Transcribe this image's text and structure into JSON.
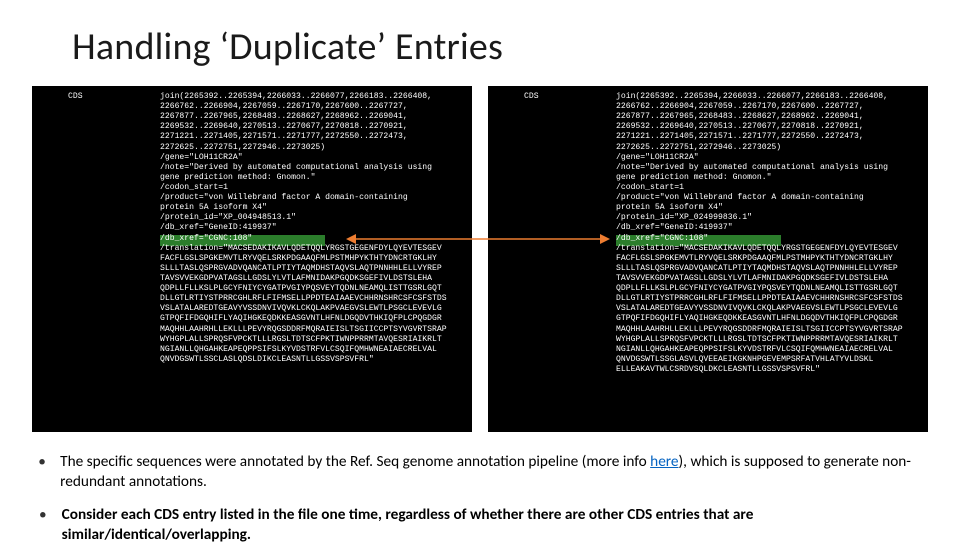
{
  "title": "Handling ‘Duplicate’ Entries",
  "cds_label": "CDS",
  "left_block": "join(2265392..2265394,2266033..2266077,2266183..2266408,\n2266762..2266904,2267059..2267170,2267600..2267727,\n2267877..2267965,2268483..2268627,2268962..2269041,\n2269532..2269640,2270513..2270677,2270818..2270921,\n2271221..2271405,2271571..2271777,2272550..2272473,\n2272625..2272751,2272946..2273025)\n/gene=\"LOH11CR2A\"\n/note=\"Derived by automated computational analysis using\ngene prediction method: Gnomon.\"\n/codon_start=1\n/product=\"von Willebrand factor A domain-containing\nprotein 5A isoform X4\"\n/protein_id=\"XP_004948513.1\"\n/db_xref=\"GeneID:419937\"\n/db_xref=\"CGNC:108\"\n/translation=\"MACSEDAKIKAVLQDETQQLYRGSTGEGENFDYLQYEVTESGEV\nFACFLGSLSPGKEMVTLRYVQELSRKPDGAAQFMLPSTMHPYKTHTYDNCRTGKLHY\nSLLLTASLQSPRGVADVQANCATLPTIYTAQMDHSTAQVSLAQTPNNHHLELLVYREP\nTAVSVVEKGDPVATAGSLLGDSLYLVTLAFMNIDAKPGQDKSGEFIVLDSTSLEHA\nQDPLLFLLKSLPLGCYFNIYCYGATPVGIYPQSVEYTQDNLNEAMQLISTTGSRLGQT\nDLLGTLRTIYSTPRRCGHLRFLFIFMSELLPPDTEAIAAEVCHHRNSHRCSFCSFSTDS\nVSLATALAREDTGEAVYVSSDNVIVQVKLCKQLAKPVAEGVSLEWTLPSGCLEVEVLG\nGTPQFIFDGQHIFLYAQIHGKEQDKKEASGVNTLHFNLDGQDVTHKIQFPLCPQGDGR\nMAQHHLAAHRHLLEKLLLPEVYRQGSDDRFMQRAIEISLTSGIICCPTSYVGVRTSRAP\nWYHGPLALLSPRQSFVPCKTLLLRGSLTDTSCFPKTIWNPPRRMTAVQESRIAIKRLT\nNGIANLLQHGAHKEAPEQPPSIFSLKYVDSTRFVLCSQIFQMHWNEAIAECRELVAL\nQNVDGSWTLSSCLASLQDSLDIKCLEASNTLLGSSVSPSVFRL\"",
  "right_block": "join(2265392..2265394,2266033..2266077,2266183..2266408,\n2266762..2266904,2267059..2267170,2267600..2267727,\n2267877..2267965,2268483..2268627,2268962..2269041,\n2269532..2269640,2270513..2270677,2270818..2270921,\n2271221..2271405,2271571..2271777,2272550..2272473,\n2272625..2272751,2272946..2273025)\n/gene=\"LOH11CR2A\"\n/note=\"Derived by automated computational analysis using\ngene prediction method: Gnomon.\"\n/codon_start=1\n/product=\"von Willebrand factor A domain-containing\nprotein 5A isoform X4\"\n/protein_id=\"XP_024999836.1\"\n/db_xref=\"GeneID:419937\"\n/db_xref=\"CGNC:108\"\n/translation=\"MACSEDAKIKAVLQDETQQLYRGSTGEGENFDYLQYEVTESGEV\nFACFLGSLSPGKEMVTLRYVQELSRKPDGAAQFMLPSTMHPYKTHTYDNCRTGKLHY\nSLLLTASLQSPRGVADVQANCATLPTIYTAQMDHSTAQVSLAQTPNNHHLELLVYREP\nTAVSVVEKGDPVATAGSLLGDSLYLVTLAFMNIDAKPGQDKSGEFIVLDSTSLEHA\nQDPLLFLLKSLPLGCYFNIYCYGATPVGIYPQSVEYTQDNLNEAMQLISTTGSRLGQT\nDLLGTLRTIYSTPRRCGHLRFLFIFMSELLPPDTEAIAAEVCHHRNSHRCSFCSFSTDS\nVSLATALAREDTGEAVYVSSDNVIVQVKLCKQLAKPVAEGVSLEWTLPSGCLEVEVLG\nGTPQFIFDGQHIFLYAQIHGKEQDKKEASGVNTLHFNLDGQDVTHKIQFPLCPQGDGR\nMAQHHLAAHRHLLEKLLLPEVYRQGSDDRFMQRAIEISLTSGIICCPTSYVGVRTSRAP\nWYHGPLALLSPRQSFVPCKTLLLRGSLTDTSCFPKTIWNPPRRMTAVQESRIAIKRLT\nNGIANLLQHGAHKEAPEQPPSIFSLKYVDSTRFVLCSQIFQMHWNEAIAECRELVAL\nQNVDGSWTLSSGLASVLQVEEAEIKGKNHPGEVEMPSRFATVHLATYVLDSKL\nELLEAKAVTWLCSRDVSQLDKCLEASNTLLGSSVSPSVFRL\"",
  "bullets": [
    {
      "t1": "The specific sequences were annotated by the Ref. Seq genome annotation pipeline (more info ",
      "link": "here",
      "t2": "), which is supposed to generate non-redundant annotations."
    },
    {
      "bold": "Consider each CDS entry listed in the file one time, regardless of whether there are other CDS entries that are similar/identical/overlapping."
    }
  ]
}
